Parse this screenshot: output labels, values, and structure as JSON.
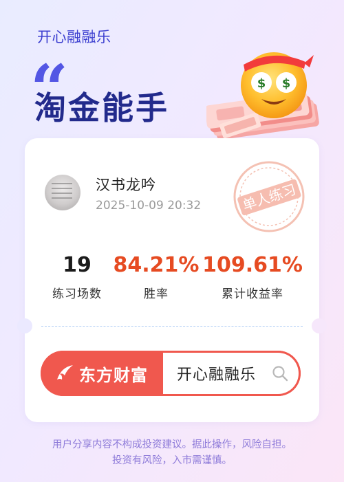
{
  "header": {
    "brand": "开心融融乐",
    "quote_mark": "“",
    "title": "淘金能手"
  },
  "card": {
    "user": {
      "name": "汉书龙吟",
      "timestamp": "2025-10-09 20:32"
    },
    "stamp": {
      "text": "单人练习"
    },
    "stats": [
      {
        "value": "19",
        "label": "练习场数",
        "color": "#1b1b1b"
      },
      {
        "value": "84.21%",
        "label": "胜率",
        "color": "#e64b22"
      },
      {
        "value": "109.61%",
        "label": "累计收益率",
        "color": "#e64b22"
      }
    ],
    "search": {
      "brand_label": "东方财富",
      "query": "开心融融乐",
      "icon": "search-icon"
    }
  },
  "disclaimer": {
    "line1": "用户分享内容不构成投资建议。据此操作，风险自担。",
    "line2": "投资有风险，入市需谨慎。"
  },
  "colors": {
    "accent": "#3c3fd0",
    "title": "#222a8c",
    "positive": "#e64b22",
    "brand_red": "#f0584e",
    "disclaimer": "#8e7bd9"
  }
}
